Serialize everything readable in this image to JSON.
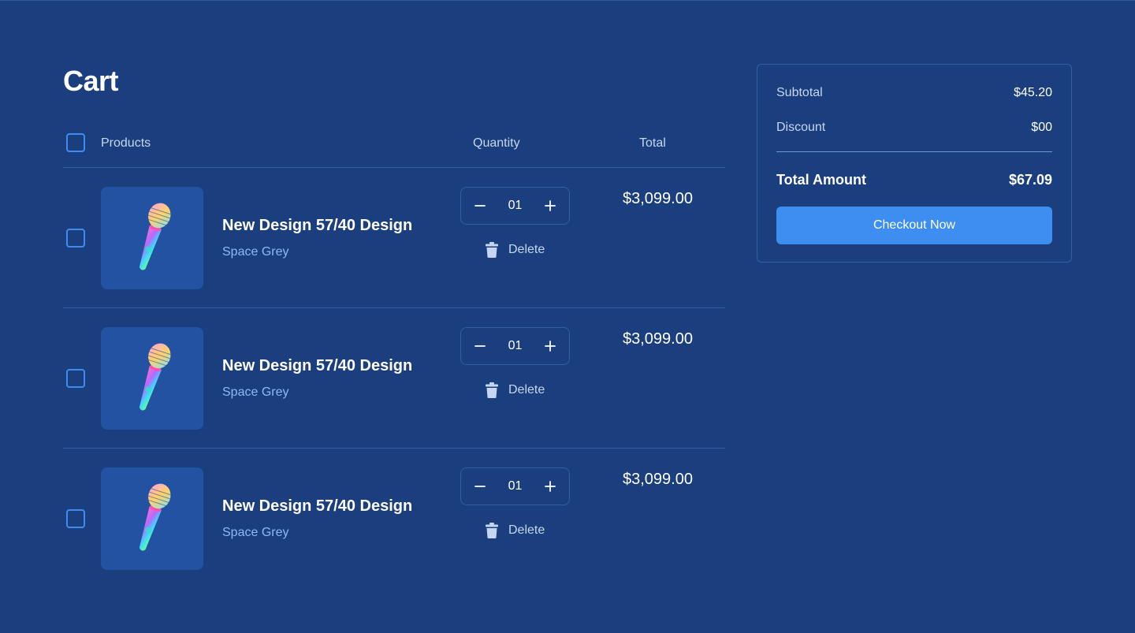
{
  "page": {
    "title": "Cart"
  },
  "table": {
    "headers": {
      "products": "Products",
      "quantity": "Quantity",
      "total": "Total"
    }
  },
  "items": [
    {
      "name": "New Design 57/40 Design",
      "variant": "Space Grey",
      "quantity": "01",
      "total": "$3,099.00",
      "delete_label": "Delete"
    },
    {
      "name": "New Design 57/40 Design",
      "variant": "Space Grey",
      "quantity": "01",
      "total": "$3,099.00",
      "delete_label": "Delete"
    },
    {
      "name": "New Design 57/40 Design",
      "variant": "Space Grey",
      "quantity": "01",
      "total": "$3,099.00",
      "delete_label": "Delete"
    }
  ],
  "summary": {
    "subtotal_label": "Subtotal",
    "subtotal_value": "$45.20",
    "discount_label": "Discount",
    "discount_value": "$00",
    "total_label": "Total Amount",
    "total_value": "$67.09",
    "checkout_label": "Checkout Now"
  },
  "colors": {
    "background": "#1b3f7e",
    "accent": "#3d8ef0",
    "thumb_bg": "#2352a3",
    "variant_text": "#8fb8f2"
  }
}
